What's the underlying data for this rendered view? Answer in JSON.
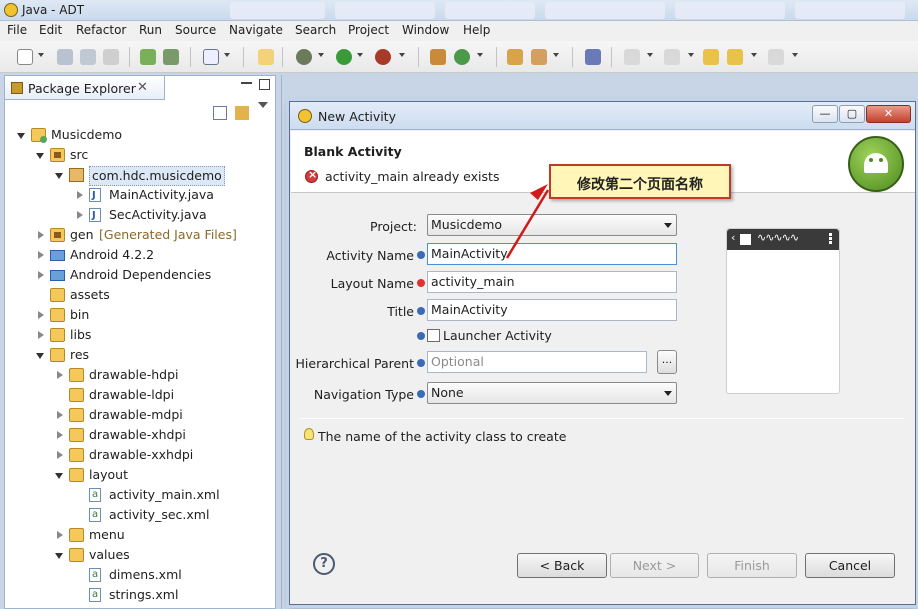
{
  "window": {
    "title": "Java - ADT"
  },
  "menu": [
    "File",
    "Edit",
    "Refactor",
    "Run",
    "Source",
    "Navigate",
    "Search",
    "Project",
    "Window",
    "Help"
  ],
  "package_explorer": {
    "tab_label": "Package Explorer",
    "tree": [
      {
        "label": "Musicdemo",
        "icon": "project-icon",
        "level": 0,
        "expander": "open"
      },
      {
        "label": "src",
        "icon": "source-folder-icon",
        "level": 1,
        "expander": "open"
      },
      {
        "label": "com.hdc.musicdemo",
        "icon": "package-icon",
        "level": 2,
        "expander": "open",
        "selected": true
      },
      {
        "label": "MainActivity.java",
        "icon": "java-file-icon",
        "level": 3,
        "expander": "closed"
      },
      {
        "label": "SecActivity.java",
        "icon": "java-file-icon",
        "level": 3,
        "expander": "closed"
      },
      {
        "label": "gen",
        "note": "[Generated Java Files]",
        "icon": "source-folder-icon",
        "level": 1,
        "expander": "closed"
      },
      {
        "label": "Android 4.2.2",
        "icon": "library-icon",
        "level": 1,
        "expander": "closed"
      },
      {
        "label": "Android Dependencies",
        "icon": "library-icon",
        "level": 1,
        "expander": "closed"
      },
      {
        "label": "assets",
        "icon": "folder-icon",
        "level": 1,
        "expander": "none"
      },
      {
        "label": "bin",
        "icon": "folder-icon",
        "level": 1,
        "expander": "closed"
      },
      {
        "label": "libs",
        "icon": "folder-icon",
        "level": 1,
        "expander": "closed"
      },
      {
        "label": "res",
        "icon": "folder-icon",
        "level": 1,
        "expander": "open"
      },
      {
        "label": "drawable-hdpi",
        "icon": "folder-icon",
        "level": 2,
        "expander": "closed"
      },
      {
        "label": "drawable-ldpi",
        "icon": "folder-icon",
        "level": 2,
        "expander": "none"
      },
      {
        "label": "drawable-mdpi",
        "icon": "folder-icon",
        "level": 2,
        "expander": "closed"
      },
      {
        "label": "drawable-xhdpi",
        "icon": "folder-icon",
        "level": 2,
        "expander": "closed"
      },
      {
        "label": "drawable-xxhdpi",
        "icon": "folder-icon",
        "level": 2,
        "expander": "closed"
      },
      {
        "label": "layout",
        "icon": "folder-icon",
        "level": 2,
        "expander": "open"
      },
      {
        "label": "activity_main.xml",
        "icon": "xml-file-icon",
        "level": 3,
        "expander": "none"
      },
      {
        "label": "activity_sec.xml",
        "icon": "xml-file-icon",
        "level": 3,
        "expander": "none"
      },
      {
        "label": "menu",
        "icon": "folder-icon",
        "level": 2,
        "expander": "closed"
      },
      {
        "label": "values",
        "icon": "folder-icon",
        "level": 2,
        "expander": "open"
      },
      {
        "label": "dimens.xml",
        "icon": "xml-file-icon",
        "level": 3,
        "expander": "none"
      },
      {
        "label": "strings.xml",
        "icon": "xml-file-icon",
        "level": 3,
        "expander": "none"
      }
    ]
  },
  "dialog": {
    "title": "New Activity",
    "header_title": "Blank Activity",
    "error_message": "activity_main already exists",
    "fields": {
      "project_label": "Project:",
      "project_value": "Musicdemo",
      "activity_name_label": "Activity Name",
      "activity_name_value": "MainActivity",
      "layout_name_label": "Layout Name",
      "layout_name_value": "activity_main",
      "title_label": "Title",
      "title_value": "MainActivity",
      "launcher_label": "Launcher Activity",
      "hier_parent_label": "Hierarchical Parent",
      "hier_parent_placeholder": "Optional",
      "browse_label": "...",
      "nav_type_label": "Navigation Type",
      "nav_type_value": "None"
    },
    "hint": "The name of the activity class to create",
    "buttons": {
      "help": "?",
      "back": "< Back",
      "next": "Next >",
      "finish": "Finish",
      "cancel": "Cancel"
    }
  },
  "annotation": {
    "text": "修改第二个页面名称",
    "border_color": "#c23a24",
    "fill_color": "#fff6b8"
  }
}
